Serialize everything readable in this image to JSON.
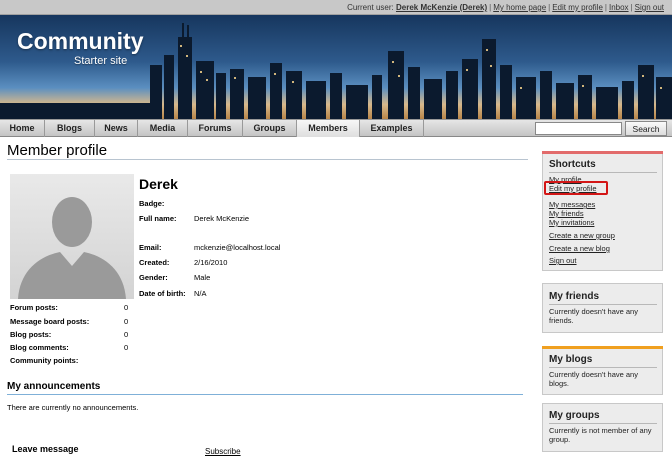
{
  "topbar": {
    "current_user_label": "Current user:",
    "current_user": "Derek McKenzie (Derek)",
    "links": [
      "My home page",
      "Edit my profile",
      "Inbox",
      "Sign out"
    ]
  },
  "banner": {
    "title": "Community",
    "subtitle": "Starter site"
  },
  "nav": {
    "items": [
      "Home",
      "Blogs",
      "News",
      "Media",
      "Forums",
      "Groups",
      "Members",
      "Examples"
    ],
    "active": "Members",
    "search_button": "Search",
    "search_value": ""
  },
  "profile": {
    "page_title": "Member profile",
    "name": "Derek",
    "fields": [
      {
        "label": "Badge:",
        "value": ""
      },
      {
        "label": "Full name:",
        "value": "Derek McKenzie"
      },
      {
        "label": "Email:",
        "value": "mckenzie@localhost.local"
      },
      {
        "label": "Created:",
        "value": "2/16/2010"
      },
      {
        "label": "Gender:",
        "value": "Male"
      },
      {
        "label": "Date of birth:",
        "value": "N/A"
      }
    ],
    "stats": [
      {
        "label": "Forum posts:",
        "value": "0"
      },
      {
        "label": "Message board posts:",
        "value": "0"
      },
      {
        "label": "Blog posts:",
        "value": "0"
      },
      {
        "label": "Blog comments:",
        "value": "0"
      },
      {
        "label": "Community points:",
        "value": ""
      }
    ]
  },
  "announcements": {
    "title": "My announcements",
    "text": "There are currently no announcements."
  },
  "message": {
    "title": "Leave message",
    "subscribe": "Subscribe"
  },
  "sidebar": {
    "shortcuts": {
      "title": "Shortcuts",
      "links": [
        "My profile",
        "Edit my profile",
        "My messages",
        "My friends",
        "My invitations",
        "Create a new group",
        "Create a new blog",
        "Sign out"
      ]
    },
    "friends": {
      "title": "My friends",
      "text": "Currently doesn't have any friends."
    },
    "blogs": {
      "title": "My blogs",
      "text": "Currently doesn't have any blogs."
    },
    "groups": {
      "title": "My groups",
      "text": "Currently is not member of any group."
    }
  },
  "colors": {
    "shortcuts_accent": "#e26b6b",
    "blogs_accent": "#f0a020",
    "highlight": "#d31616"
  }
}
